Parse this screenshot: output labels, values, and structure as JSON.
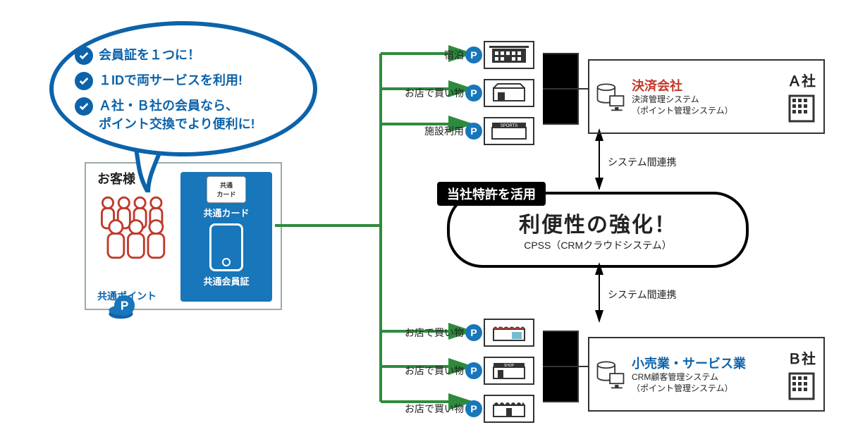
{
  "bubble": {
    "items": [
      "会員証を１つに！",
      "１IDで両サービスを利用!",
      "Ａ社・Ｂ社の会員なら、\nポイント交換でより便利に!"
    ]
  },
  "customer": {
    "title": "お客様",
    "common_point": "共通ポイント",
    "card_small_label": "共通\nカード",
    "card_label": "共通カード",
    "phone_label": "共通会員証",
    "p_badge": "P"
  },
  "services_top": [
    {
      "label": "宿泊",
      "icon": "hotel"
    },
    {
      "label": "お店で買い物",
      "icon": "store"
    },
    {
      "label": "施設利用",
      "icon": "sports"
    }
  ],
  "services_bottom": [
    {
      "label": "お店で買い物",
      "icon": "shop1"
    },
    {
      "label": "お店で買い物",
      "icon": "shop2"
    },
    {
      "label": "お店で買い物",
      "icon": "shop3"
    }
  ],
  "company_a": {
    "title": "決済会社",
    "sub1": "決済管理システム",
    "sub2": "（ポイント管理システム）",
    "tag": "Ａ社"
  },
  "company_b": {
    "title": "小売業・サービス業",
    "sub1": "CRM顧客管理システム",
    "sub2": "（ポイント管理システム）",
    "tag": "Ｂ社"
  },
  "capsule": {
    "badge": "当社特許を活用",
    "title": "利便性の強化！",
    "sub": "CPSS（CRMクラウドシステム）"
  },
  "link_label": "システム間連携",
  "p_text": "P",
  "colors": {
    "brand_blue": "#0c63aa",
    "green": "#2e8b3d",
    "red": "#c0392b",
    "black": "#000"
  }
}
